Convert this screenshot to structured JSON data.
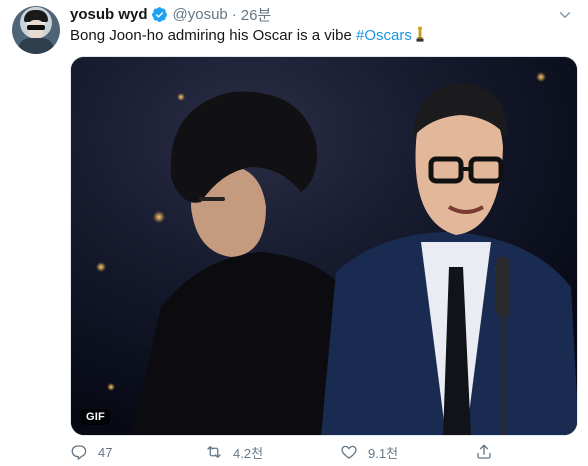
{
  "tweet": {
    "display_name": "yosub wyd",
    "handle": "@yosub",
    "separator": "·",
    "timestamp": "26분",
    "text_prefix": "Bong Joon-ho admiring his Oscar is a vibe ",
    "hashtag": "#Oscars",
    "emoji": "oscar-trophy"
  },
  "media": {
    "badge": "GIF"
  },
  "actions": {
    "reply_count": "47",
    "retweet_count": "4.2천",
    "like_count": "9.1천"
  },
  "colors": {
    "link": "#1b95e0",
    "secondary_text": "#657786",
    "verified": "#1da1f2"
  }
}
